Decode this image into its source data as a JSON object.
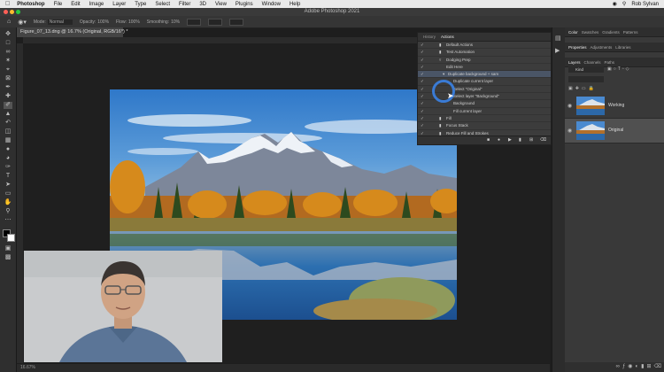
{
  "menubar": {
    "app_name": "Photoshop",
    "items": [
      "File",
      "Edit",
      "Image",
      "Layer",
      "Type",
      "Select",
      "Filter",
      "3D",
      "View",
      "Plugins",
      "Window",
      "Help"
    ],
    "user": "Rob Sylvan"
  },
  "window": {
    "title": "Adobe Photoshop 2021"
  },
  "options_bar": {
    "mode_label": "Mode:",
    "mode_value": "Normal",
    "opacity_label": "Opacity:",
    "opacity_value": "100%",
    "flow_label": "Flow:",
    "flow_value": "100%",
    "smoothing_label": "Smoothing:",
    "smoothing_value": "10%"
  },
  "document": {
    "tab_title": "Figure_07_13.dng @ 16.7% (Original, RGB/16*) *",
    "zoom": "16.67%"
  },
  "actions_panel": {
    "tabs": [
      "History",
      "Actions"
    ],
    "rows": [
      {
        "label": "Default Actions",
        "indent": 1,
        "folder": true
      },
      {
        "label": "Test Automation",
        "indent": 1,
        "folder": true
      },
      {
        "label": "Dodging Prep",
        "indent": 1,
        "folder": true
      },
      {
        "label": "Edit Here",
        "indent": 2,
        "folder": false
      },
      {
        "label": "Duplicate background + sam",
        "indent": 2,
        "folder": false,
        "selected": true
      },
      {
        "label": "Duplicate current layer",
        "indent": 3,
        "folder": false
      },
      {
        "label": "Select \"Original\"",
        "indent": 3,
        "folder": false
      },
      {
        "label": "Select layer \"Background\"",
        "indent": 3,
        "folder": false
      },
      {
        "label": "Background",
        "indent": 3,
        "folder": false
      },
      {
        "label": "Fill current layer",
        "indent": 3,
        "folder": false
      },
      {
        "label": "Fill",
        "indent": 1,
        "folder": true
      },
      {
        "label": "Focus Stack",
        "indent": 1,
        "folder": true
      },
      {
        "label": "Reduce Fill and Strokes",
        "indent": 1,
        "folder": true
      },
      {
        "label": "...",
        "indent": 1,
        "folder": true
      }
    ]
  },
  "right_panels": {
    "top_tabs": [
      "Color",
      "Swatches",
      "Gradients",
      "Patterns"
    ],
    "mid_tabs": [
      "Properties",
      "Adjustments",
      "Libraries"
    ],
    "layer_tabs": [
      "Layers",
      "Channels",
      "Paths"
    ],
    "kind_label": "Kind",
    "layers": [
      {
        "name": "Working",
        "selected": false
      },
      {
        "name": "Original",
        "selected": true
      }
    ]
  },
  "icons": [
    "apple-icon",
    "move-tool-icon",
    "brush-tool-icon",
    "eye-icon",
    "play-icon",
    "stop-icon",
    "record-icon",
    "trash-icon",
    "folder-icon"
  ]
}
